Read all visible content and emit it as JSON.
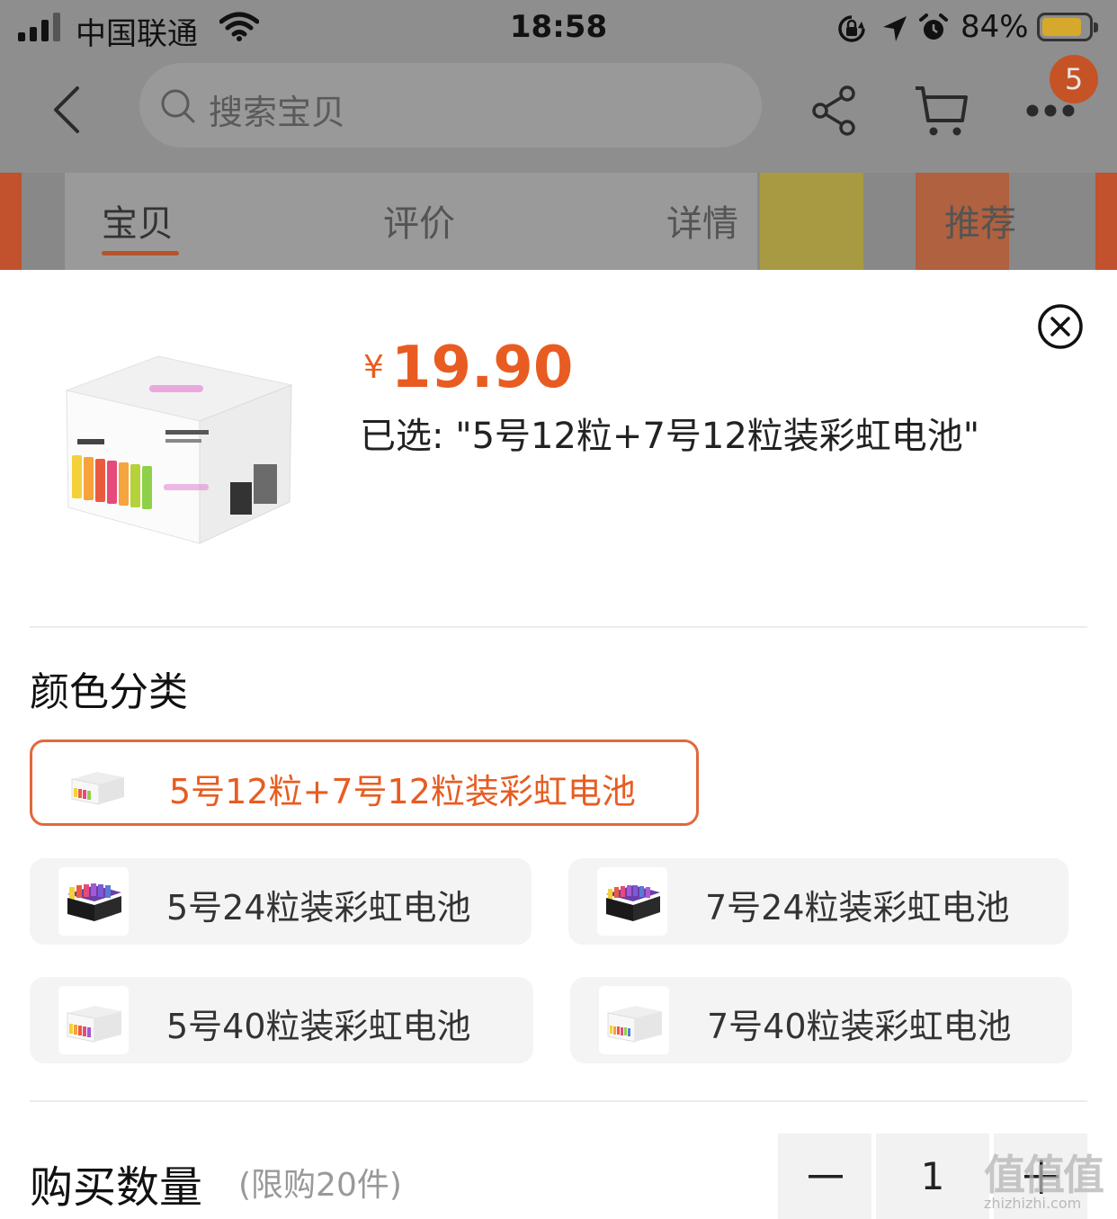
{
  "status_bar": {
    "carrier": "中国联通",
    "time": "18:58",
    "battery_percent": "84%"
  },
  "nav": {
    "search_placeholder": "搜索宝贝",
    "cart_badge": "5"
  },
  "tabs": [
    {
      "label": "宝贝",
      "active": true
    },
    {
      "label": "评价",
      "active": false
    },
    {
      "label": "详情",
      "active": false
    },
    {
      "label": "推荐",
      "active": false
    }
  ],
  "product": {
    "currency": "¥",
    "price": "19.90",
    "selected_text": "已选: \"5号12粒+7号12粒装彩虹电池\""
  },
  "variants": {
    "title": "颜色分类",
    "options": [
      {
        "label": "5号12粒+7号12粒装彩虹电池",
        "selected": true
      },
      {
        "label": "5号24粒装彩虹电池",
        "selected": false
      },
      {
        "label": "7号24粒装彩虹电池",
        "selected": false
      },
      {
        "label": "5号40粒装彩虹电池",
        "selected": false
      },
      {
        "label": "7号40粒装彩虹电池",
        "selected": false
      }
    ]
  },
  "quantity": {
    "title": "购买数量",
    "limit": "(限购20件)",
    "value": "1"
  },
  "watermark": {
    "text": "值值值",
    "url": "zhizhizhi.com"
  },
  "colors": {
    "accent": "#e85c21",
    "selected_border": "#e2683a",
    "overlay": "#8e8e8e"
  }
}
